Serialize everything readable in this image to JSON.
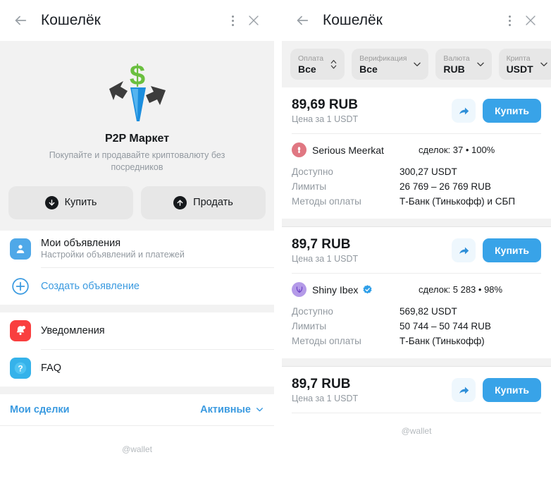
{
  "left": {
    "header": {
      "title": "Кошелёк",
      "back_icon": "arrow-left-icon",
      "menu_icon": "more-vertical-icon",
      "close_icon": "close-icon"
    },
    "hero": {
      "illustration": "p2p-market-arrows-icon",
      "title": "P2P Маркет",
      "subtitle": "Покупайте и продавайте криптовалюту без посредников",
      "buy_label": "Купить",
      "sell_label": "Продать",
      "buy_icon": "arrow-down-circle-icon",
      "sell_icon": "arrow-up-circle-icon"
    },
    "menu": [
      {
        "icon": "user-profile-icon",
        "icon_bg": "#4fa8e8",
        "title": "Мои объявления",
        "subtitle": "Настройки объявлений и платежей",
        "link": false
      },
      {
        "icon": "plus-circle-icon",
        "icon_bg": "transparent",
        "title": "Создать объявление",
        "subtitle": "",
        "link": true
      }
    ],
    "menu2": [
      {
        "icon": "bell-icon",
        "icon_bg": "#f93f3f",
        "title": "Уведомления"
      },
      {
        "icon": "question-mark-icon",
        "icon_bg": "#35b2ea",
        "title": "FAQ"
      }
    ],
    "deals": {
      "label": "Мои сделки",
      "filter_value": "Активные",
      "filter_icon": "chevron-down-icon"
    },
    "footer": "@wallet"
  },
  "right": {
    "header": {
      "title": "Кошелёк",
      "back_icon": "arrow-left-icon",
      "menu_icon": "more-vertical-icon",
      "close_icon": "close-icon"
    },
    "filters": [
      {
        "label": "Оплата",
        "value": "Все",
        "icon": "chevron-up-down-icon"
      },
      {
        "label": "Верификация",
        "value": "Все",
        "icon": "chevron-down-icon"
      },
      {
        "label": "Валюта",
        "value": "RUB",
        "icon": "chevron-down-icon"
      },
      {
        "label": "Крипта",
        "value": "USDT",
        "icon": "chevron-down-icon"
      }
    ],
    "labels": {
      "available": "Доступно",
      "limits": "Лимиты",
      "payment_methods": "Методы оплаты",
      "share_icon": "share-arrow-icon",
      "buy_label": "Купить"
    },
    "offers": [
      {
        "price": "89,69 RUB",
        "price_sub": "Цена за 1 USDT",
        "buy_label": "Купить",
        "trader": "Serious Meerkat",
        "avatar_bg": "#e07782",
        "avatar_glyph": "meerkat-avatar-icon",
        "verified": false,
        "stats": "сделок: 37 • 100%",
        "available": "300,27 USDT",
        "limits": "26 769 – 26 769 RUB",
        "payment_methods": "Т-Банк (Тинькофф) и СБП"
      },
      {
        "price": "89,7 RUB",
        "price_sub": "Цена за 1 USDT",
        "buy_label": "Купить",
        "trader": "Shiny Ibex",
        "avatar_bg": "#b49ae8",
        "avatar_glyph": "ibex-avatar-icon",
        "verified": true,
        "stats": "сделок: 5 283 • 98%",
        "available": "569,82 USDT",
        "limits": "50 744 – 50 744 RUB",
        "payment_methods": "Т-Банк (Тинькофф)"
      },
      {
        "price": "89,7 RUB",
        "price_sub": "Цена за 1 USDT",
        "buy_label": "Купить",
        "trader": "",
        "avatar_bg": "",
        "avatar_glyph": "",
        "verified": false,
        "stats": "",
        "available": "",
        "limits": "",
        "payment_methods": ""
      }
    ],
    "footer": "@wallet"
  },
  "colors": {
    "accent_blue": "#38a3e8",
    "link_blue": "#3a9ae0",
    "band_gray": "#f2f2f2",
    "chip_gray": "#e7e7e7",
    "muted_text": "#9299a0",
    "danger_red": "#f93f3f"
  }
}
